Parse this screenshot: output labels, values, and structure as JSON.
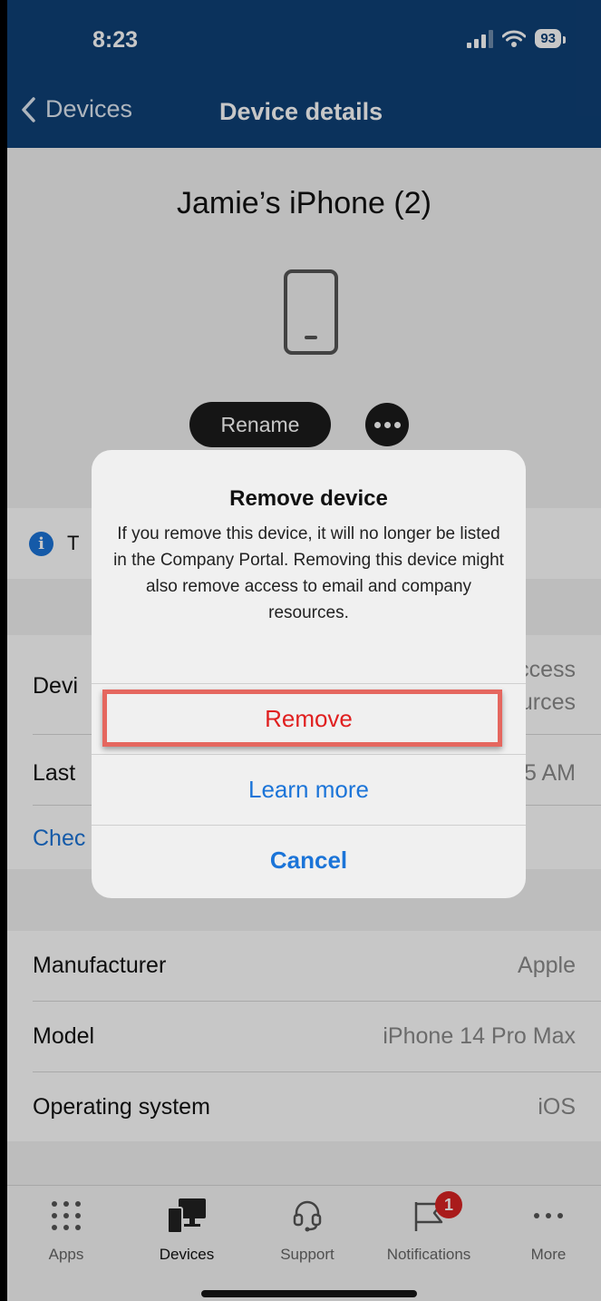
{
  "status_bar": {
    "time": "8:23",
    "battery": "93"
  },
  "nav": {
    "back_label": "Devices",
    "title": "Device details"
  },
  "device": {
    "name": "Jamie’s iPhone (2)",
    "rename_label": "Rename"
  },
  "info_banner": {
    "text": "T"
  },
  "details_partial": [
    {
      "key": "Devi",
      "value_line1": "ccess",
      "value_line2": "urces"
    },
    {
      "key": "Last",
      "value": "5 AM"
    }
  ],
  "check_link": "Chec",
  "properties": [
    {
      "key": "Manufacturer",
      "value": "Apple"
    },
    {
      "key": "Model",
      "value": "iPhone 14 Pro Max"
    },
    {
      "key": "Operating system",
      "value": "iOS"
    }
  ],
  "dialog": {
    "title": "Remove device",
    "message": "If you remove this device, it will no longer be listed in the Company Portal. Removing this device might also remove access to email and company resources.",
    "remove_label": "Remove",
    "learn_more_label": "Learn more",
    "cancel_label": "Cancel"
  },
  "tabs": [
    {
      "label": "Apps"
    },
    {
      "label": "Devices"
    },
    {
      "label": "Support"
    },
    {
      "label": "Notifications",
      "badge": "1"
    },
    {
      "label": "More"
    }
  ],
  "colors": {
    "header": "#0f4076",
    "link": "#1b74d8",
    "destructive": "#e02020",
    "highlight": "#e5675f"
  }
}
